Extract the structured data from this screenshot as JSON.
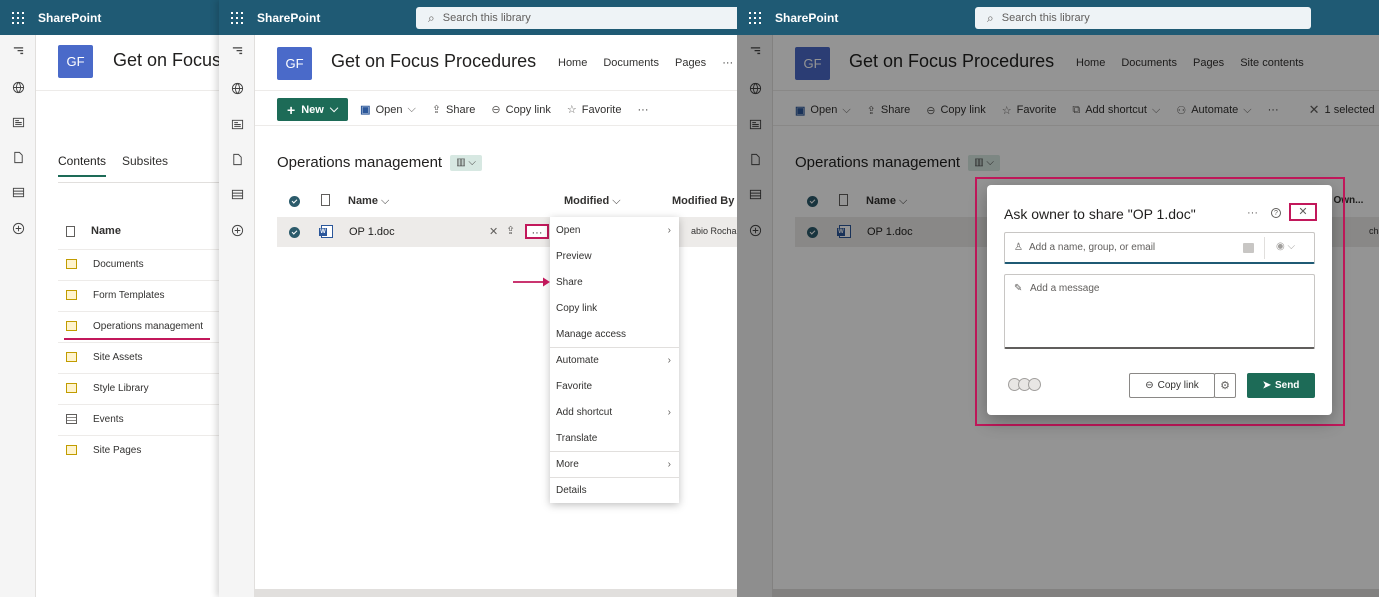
{
  "brand": "SharePoint",
  "search_placeholder": "Search this library",
  "site_logo": "GF",
  "panel1": {
    "site_title": "Get on Focus",
    "tabs": [
      "Contents",
      "Subsites"
    ],
    "column_name": "Name",
    "items": [
      "Documents",
      "Form Templates",
      "Operations management",
      "Site Assets",
      "Style Library",
      "Events",
      "Site Pages"
    ]
  },
  "panel2": {
    "site_title": "Get on Focus Procedures",
    "nav": [
      "Home",
      "Documents",
      "Pages",
      "···"
    ],
    "commands": {
      "new": "New",
      "open": "Open",
      "share": "Share",
      "copy_link": "Copy link",
      "favorite": "Favorite",
      "more": "···"
    },
    "library_title": "Operations management",
    "columns": {
      "name": "Name",
      "modified": "Modified",
      "modified_by": "Modified By"
    },
    "file_name": "OP 1.doc",
    "row_more": "···",
    "modified_by_value": "abio Rocha",
    "menu": [
      {
        "label": "Open",
        "submenu": true
      },
      {
        "label": "Preview",
        "submenu": false
      },
      {
        "label": "Share",
        "submenu": false
      },
      {
        "label": "Copy link",
        "submenu": false
      },
      {
        "label": "Manage access",
        "submenu": false
      },
      {
        "label": "Automate",
        "submenu": true
      },
      {
        "label": "Favorite",
        "submenu": false
      },
      {
        "label": "Add shortcut",
        "submenu": true
      },
      {
        "label": "Translate",
        "submenu": false
      },
      {
        "label": "More",
        "submenu": true
      },
      {
        "label": "Details",
        "submenu": false
      }
    ]
  },
  "panel3": {
    "site_title": "Get on Focus Procedures",
    "nav": [
      "Home",
      "Documents",
      "Pages",
      "Site contents"
    ],
    "commands": {
      "open": "Open",
      "share": "Share",
      "copy_link": "Copy link",
      "favorite": "Favorite",
      "add_shortcut": "Add shortcut",
      "automate": "Automate",
      "more": "···",
      "selected": "1 selected"
    },
    "library_title": "Operations management",
    "columns": {
      "name": "Name",
      "owner_partial": "en Own..."
    },
    "file_name": "OP 1.doc",
    "row_partial": "cha",
    "dialog": {
      "title": "Ask owner to share \"OP 1.doc\"",
      "more": "···",
      "people_placeholder": "Add a name, group, or email",
      "message_placeholder": "Add a message",
      "copy_link": "Copy link",
      "send": "Send"
    }
  },
  "colors": {
    "suitebar": "#1f5a74",
    "accent": "#1d6b57",
    "highlight": "#c2185b",
    "logo": "#4a6ac9"
  }
}
